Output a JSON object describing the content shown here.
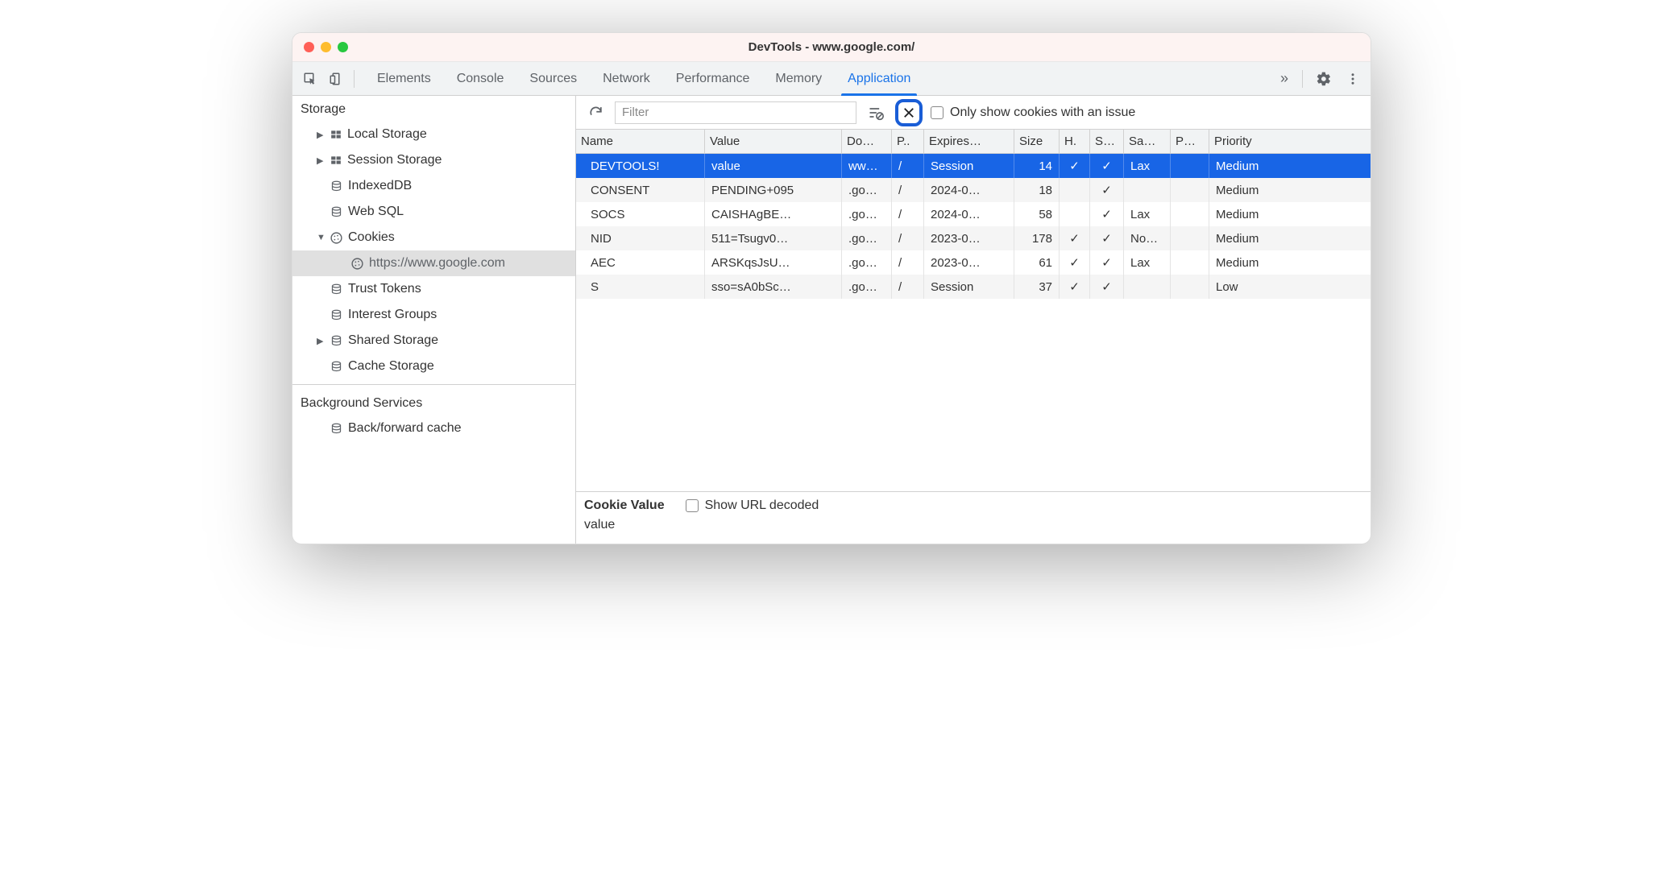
{
  "window": {
    "title": "DevTools - www.google.com/"
  },
  "tabs": {
    "items": [
      "Elements",
      "Console",
      "Sources",
      "Network",
      "Performance",
      "Memory",
      "Application"
    ],
    "active_index": 6
  },
  "filterbar": {
    "placeholder": "Filter",
    "only_issues_label": "Only show cookies with an issue"
  },
  "sidebar": {
    "section1_title": "Storage",
    "items": [
      {
        "label": "Local Storage",
        "icon": "grid",
        "arrow": "▶",
        "indent": 1
      },
      {
        "label": "Session Storage",
        "icon": "grid",
        "arrow": "▶",
        "indent": 1
      },
      {
        "label": "IndexedDB",
        "icon": "db",
        "arrow": "",
        "indent": 1
      },
      {
        "label": "Web SQL",
        "icon": "db",
        "arrow": "",
        "indent": 1
      },
      {
        "label": "Cookies",
        "icon": "cookie",
        "arrow": "▼",
        "indent": 1
      },
      {
        "label": "https://www.google.com",
        "icon": "cookie",
        "arrow": "",
        "indent": 2,
        "selected": true
      },
      {
        "label": "Trust Tokens",
        "icon": "db",
        "arrow": "",
        "indent": 1
      },
      {
        "label": "Interest Groups",
        "icon": "db",
        "arrow": "",
        "indent": 1
      },
      {
        "label": "Shared Storage",
        "icon": "db",
        "arrow": "▶",
        "indent": 1
      },
      {
        "label": "Cache Storage",
        "icon": "db",
        "arrow": "",
        "indent": 1
      }
    ],
    "section2_title": "Background Services",
    "items2": [
      {
        "label": "Back/forward cache",
        "icon": "db",
        "arrow": "",
        "indent": 1
      }
    ]
  },
  "table": {
    "columns": [
      "Name",
      "Value",
      "Do…",
      "P..",
      "Expires…",
      "Size",
      "H.",
      "S…",
      "Sa…",
      "P…",
      "Priority"
    ],
    "rows": [
      {
        "name": "DEVTOOLS!",
        "value": "value",
        "domain": "ww…",
        "path": "/",
        "expires": "Session",
        "size": "14",
        "http": "✓",
        "secure": "✓",
        "same": "Lax",
        "part": "",
        "priority": "Medium",
        "selected": true
      },
      {
        "name": "CONSENT",
        "value": "PENDING+095",
        "domain": ".go…",
        "path": "/",
        "expires": "2024-0…",
        "size": "18",
        "http": "",
        "secure": "✓",
        "same": "",
        "part": "",
        "priority": "Medium"
      },
      {
        "name": "SOCS",
        "value": "CAISHAgBE…",
        "domain": ".go…",
        "path": "/",
        "expires": "2024-0…",
        "size": "58",
        "http": "",
        "secure": "✓",
        "same": "Lax",
        "part": "",
        "priority": "Medium"
      },
      {
        "name": "NID",
        "value": "511=Tsugv0…",
        "domain": ".go…",
        "path": "/",
        "expires": "2023-0…",
        "size": "178",
        "http": "✓",
        "secure": "✓",
        "same": "No…",
        "part": "",
        "priority": "Medium"
      },
      {
        "name": "AEC",
        "value": "ARSKqsJsU…",
        "domain": ".go…",
        "path": "/",
        "expires": "2023-0…",
        "size": "61",
        "http": "✓",
        "secure": "✓",
        "same": "Lax",
        "part": "",
        "priority": "Medium"
      },
      {
        "name": "S",
        "value": "sso=sA0bSc…",
        "domain": ".go…",
        "path": "/",
        "expires": "Session",
        "size": "37",
        "http": "✓",
        "secure": "✓",
        "same": "",
        "part": "",
        "priority": "Low"
      }
    ]
  },
  "detail": {
    "label": "Cookie Value",
    "decoded_label": "Show URL decoded",
    "value": "value"
  }
}
